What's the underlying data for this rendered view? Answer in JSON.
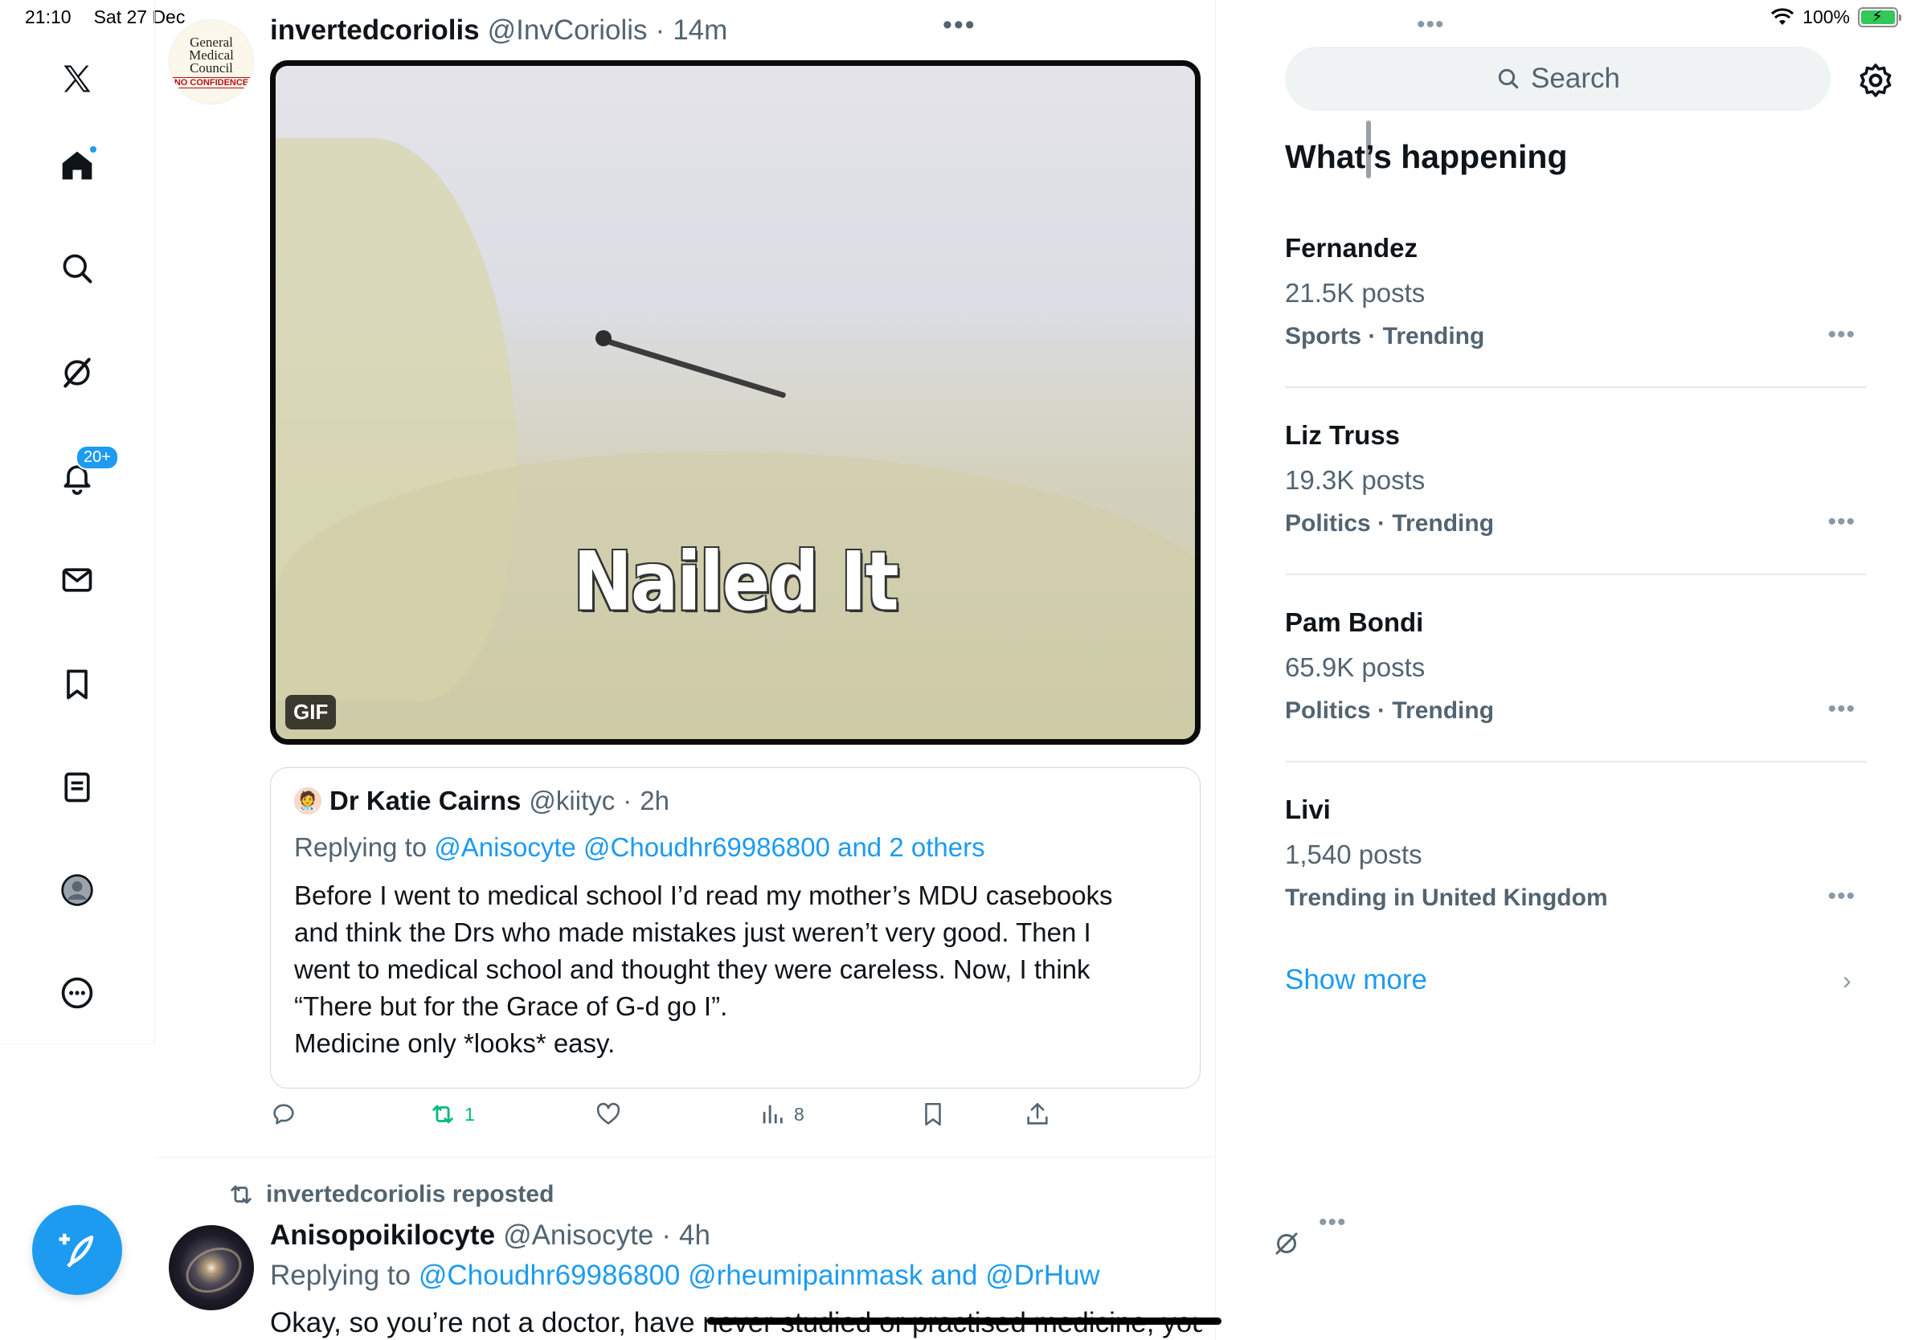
{
  "status": {
    "time": "21:10",
    "date": "Sat 27 Dec",
    "battery": "100%"
  },
  "nav": {
    "logo": "x-logo-icon",
    "notifications_badge": "20+",
    "items": [
      "home-icon",
      "search-icon",
      "grok-icon",
      "bell-icon",
      "mail-icon",
      "bookmark-icon",
      "list-icon",
      "profile-icon",
      "more-icon"
    ]
  },
  "post1": {
    "avatar": {
      "lines": [
        "General",
        "Medical",
        "Council"
      ],
      "stamp": "NO CONFIDENCE"
    },
    "name": "invertedcoriolis",
    "handle": "@InvCoriolis",
    "sep": "·",
    "time": "14m",
    "media": {
      "caption": "Nailed It",
      "badge": "GIF"
    },
    "quote": {
      "name": "Dr Katie Cairns",
      "handle": "@kiityc",
      "sep": "·",
      "time": "2h",
      "replying_prefix": "Replying to",
      "replying_to": "@Anisocyte @Choudhr69986800 and 2 others",
      "body": [
        "Before I went to medical school I’d read my mother’s MDU casebooks",
        "and think the Drs who made mistakes just weren’t very good. Then I",
        "went to medical school and thought they were careless. Now, I think",
        "“There but for the Grace of G-d go I”.",
        "Medicine only *looks* easy."
      ]
    },
    "actions": {
      "reposts": "1",
      "views": "8"
    }
  },
  "post2": {
    "repost_label": "invertedcoriolis reposted",
    "name": "Anisopoikilocyte",
    "handle": "@Anisocyte",
    "sep": "·",
    "time": "4h",
    "replying_prefix": "Replying to",
    "replying_to": "@Choudhr69986800 @rheumipainmask and @DrHuw",
    "body": "Okay, so you’re not a doctor, have never studied or practised medicine, you"
  },
  "sidebar": {
    "search_placeholder": "Search",
    "section_title": "What’s happening",
    "trends": [
      {
        "name": "Fernandez",
        "posts": "21.5K posts",
        "category": "Sports · Trending"
      },
      {
        "name": "Liz Truss",
        "posts": "19.3K posts",
        "category": "Politics · Trending"
      },
      {
        "name": "Pam Bondi",
        "posts": "65.9K posts",
        "category": "Politics · Trending"
      },
      {
        "name": "Livi",
        "posts": "1,540 posts",
        "category": "Trending in United Kingdom"
      }
    ],
    "show_more": "Show more"
  },
  "colors": {
    "accent": "#1d9bf0",
    "repost": "#00ba7c",
    "muted": "#536471"
  }
}
